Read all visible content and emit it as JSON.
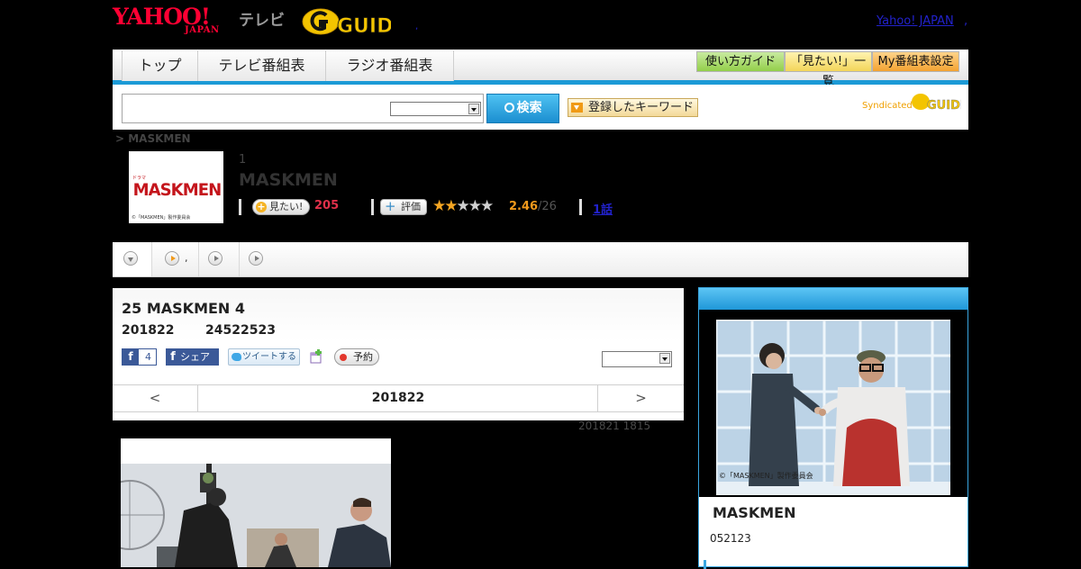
{
  "header": {
    "yahoo_text": "YAHOO!",
    "japan_text": "JAPAN",
    "tv_text": "テレビ",
    "gguide_text": "GUIDE",
    "link_text": "Yahoo! JAPAN",
    "sep": ",",
    "sep2": ","
  },
  "nav": {
    "tabs": [
      "トップ",
      "テレビ番組表",
      "ラジオ番組表"
    ],
    "buttons": [
      "使い方ガイド",
      "「見たい!」一覧",
      "My番組表設定"
    ]
  },
  "search": {
    "placeholder": "",
    "button_label": "検索",
    "keyword_button": "登録したキーワード",
    "syndicated": "Syndicated",
    "syndicated_logo": "GUIDE"
  },
  "breadcrumb": "> MASKMEN",
  "program": {
    "thumb_title": "MASKMEN",
    "thumb_small": "ドラマ",
    "thumb_copyright": "©「MASKMEN」製作委員会",
    "number": "1",
    "title": "MASKMEN",
    "want_label": "見たい!",
    "want_count": "205",
    "rate_label": "評価",
    "rating": "2.46",
    "rating_count": "/26",
    "stars_filled": 2,
    "stars_total": 5,
    "episode_link": "1話"
  },
  "tabbar": {
    "tab2_text": ","
  },
  "episode": {
    "title": "25 MASKMEN 4",
    "date": "201822",
    "time": "24522523",
    "fb_count": "4",
    "fb_share": "シェア",
    "tweet": "ツイートする",
    "reserve": "予約",
    "pager_prev": "<",
    "pager_current": "201822",
    "pager_next": ">",
    "airtime": "201821  1815"
  },
  "side": {
    "img_copyright": "©「MASKMEN」製作委員会",
    "title": "MASKMEN",
    "date": "052123"
  },
  "colors": {
    "accent": "#1c9ad6",
    "yahoo_red": "#ff0033",
    "rating_orange": "#f19a1c",
    "want_pink": "#e0304a"
  }
}
